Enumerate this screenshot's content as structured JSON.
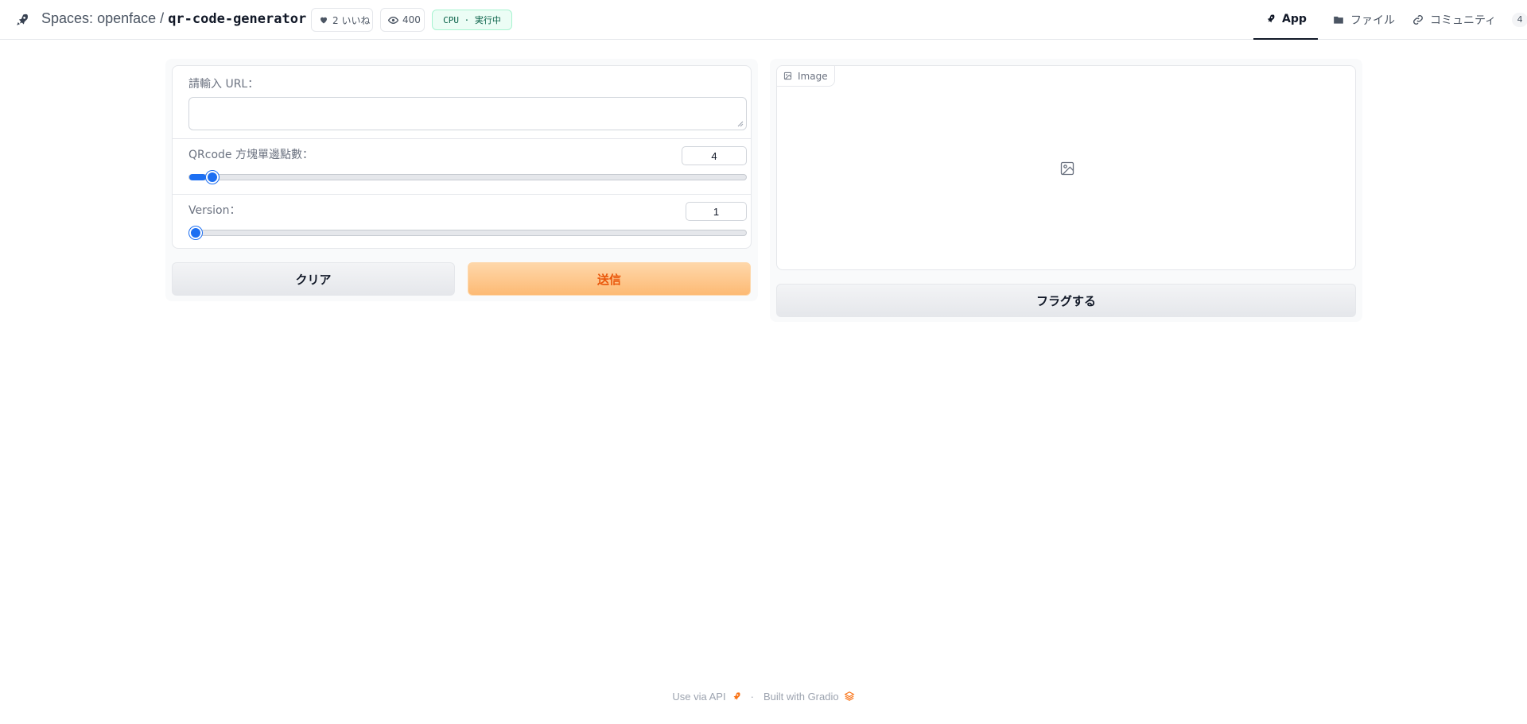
{
  "header": {
    "title_prefix": "Spaces:",
    "owner": "openface",
    "separator": "/",
    "repo": "qr-code-generator",
    "likes": "2 いいね",
    "views": "400",
    "status": "CPU · 実行中",
    "tabs": {
      "app": "App",
      "files": "ファイル",
      "community": "コミュニティ",
      "community_count": "4"
    }
  },
  "form": {
    "url_label": "請輸入 URL：",
    "url_value": "",
    "qr_label": "QRcode 方塊單邊點數：",
    "qr_value": "4",
    "qr_slider_fraction": 0.03,
    "version_label": "Version：",
    "version_value": "1",
    "version_slider_fraction": 0.0,
    "clear_label": "クリア",
    "submit_label": "送信"
  },
  "output": {
    "image_label": "Image",
    "flag_label": "フラグする"
  },
  "footer": {
    "api_label": "Use via API",
    "separator": "·",
    "built_label": "Built with Gradio"
  },
  "colors": {
    "accent_orange": "#ea580c",
    "slider_blue": "#1d6ff2",
    "status_green": "#065f46"
  }
}
